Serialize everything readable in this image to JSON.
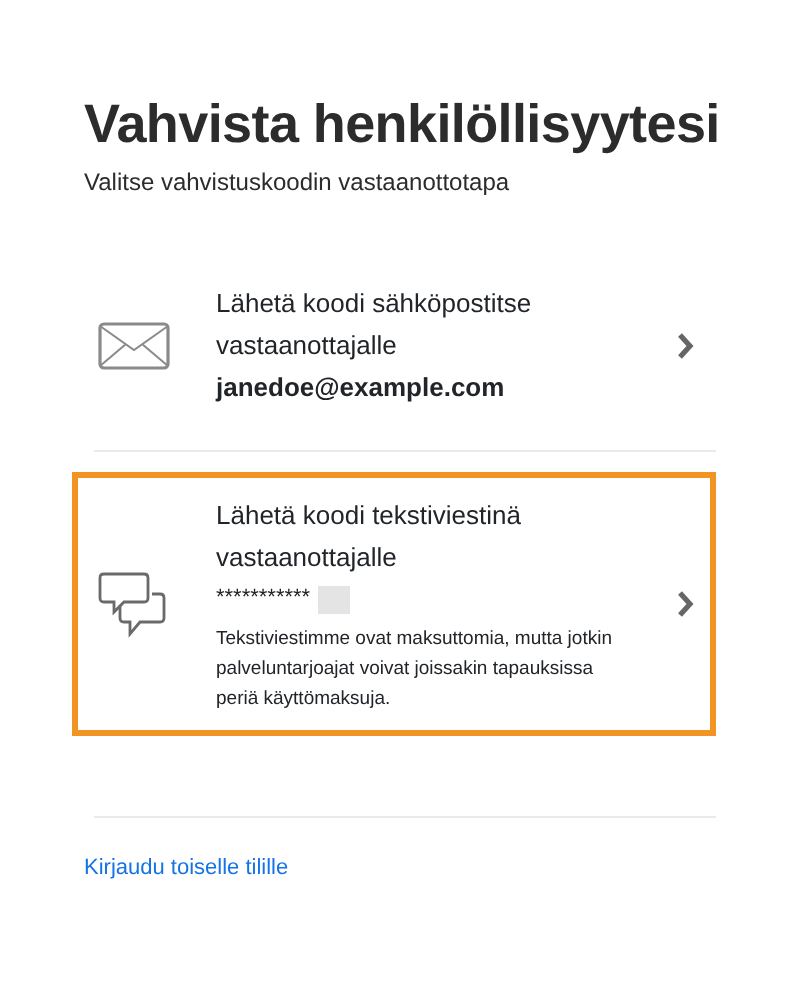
{
  "title": "Vahvista henkilöllisyytesi",
  "subtitle": "Valitse vahvistuskoodin vastaanottotapa",
  "options": [
    {
      "kind": "email",
      "selected": false,
      "label": "Lähetä koodi sähköpostitse vastaanottajalle",
      "recipient": "janedoe@example.com"
    },
    {
      "kind": "sms",
      "selected": true,
      "label": "Lähetä koodi tekstiviestinä vastaanottajalle",
      "recipient": "***********",
      "redacted": true,
      "note": "Tekstiviestimme ovat maksuttomia, mutta jotkin palveluntarjoajat voivat joissakin tapauksissa periä käyttömaksuja."
    }
  ],
  "link": "Kirjaudu toiselle tilille"
}
